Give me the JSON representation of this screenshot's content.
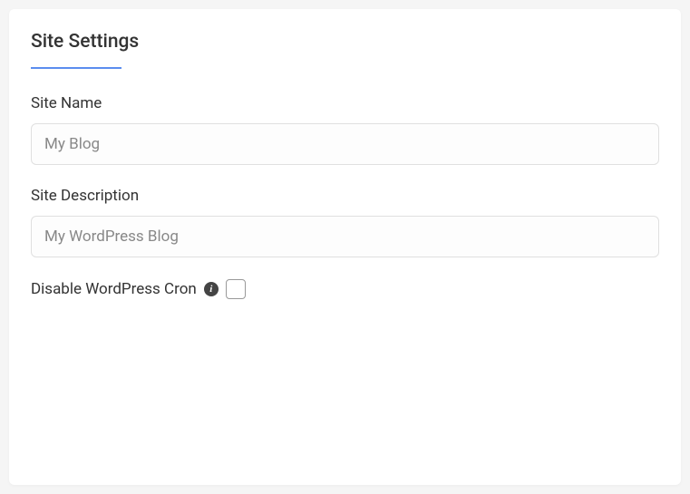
{
  "title": "Site Settings",
  "fields": {
    "site_name": {
      "label": "Site Name",
      "value": "My Blog"
    },
    "site_description": {
      "label": "Site Description",
      "value": "My WordPress Blog"
    },
    "disable_cron": {
      "label": "Disable WordPress Cron",
      "checked": false
    }
  }
}
